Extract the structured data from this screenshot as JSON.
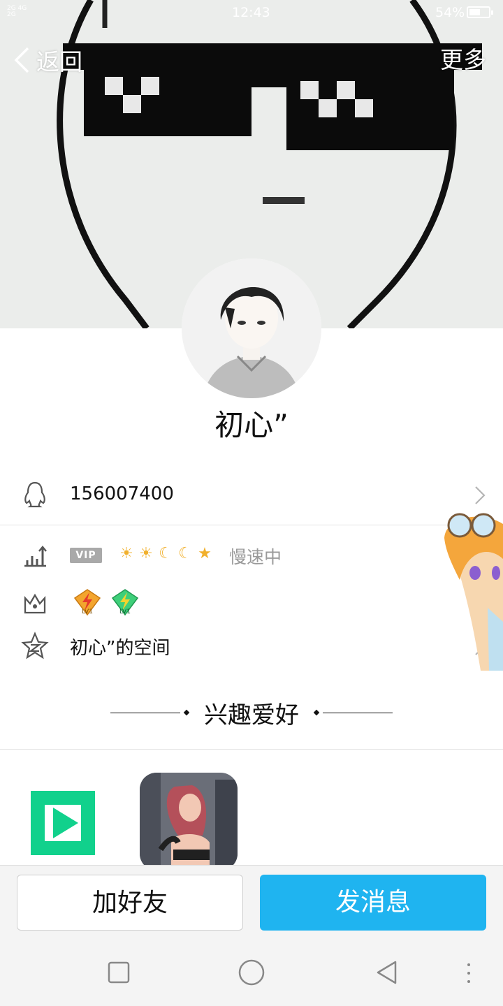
{
  "status_bar": {
    "time": "12:43",
    "signal_top": "2G 4G",
    "signal_bottom": "2G",
    "battery": "54%"
  },
  "nav": {
    "back_label": "返回",
    "more_label": "更多"
  },
  "profile": {
    "nickname": "初心”",
    "qq_number": "156007400"
  },
  "level": {
    "vip_badge": "VIP",
    "level_icons": [
      "sun-icon",
      "sun-icon",
      "moon-icon",
      "moon-icon",
      "star-icon"
    ],
    "status": "慢速中"
  },
  "honors": {
    "badges": [
      "LV1",
      "LV1"
    ]
  },
  "space": {
    "label": "初心”的空间"
  },
  "interests": {
    "title": "兴趣爱好"
  },
  "actions": {
    "add_friend": "加好友",
    "send_message": "发消息"
  },
  "colors": {
    "primary": "#1fb4f0",
    "divider": "#e3e3e3",
    "muted_text": "#9a9a9a"
  }
}
